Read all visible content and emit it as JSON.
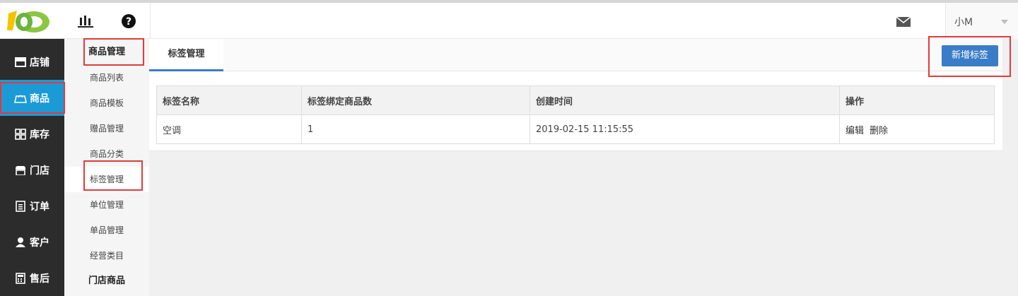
{
  "app": {
    "logo_icon": "logo-100-icon",
    "top_icons": [
      "bar-chart-icon",
      "help-circle-icon"
    ],
    "mail_icon": "mail-icon",
    "user_name": "小M",
    "colors": {
      "nav_bg": "#2c2c2c",
      "nav_active": "#1b9ad6",
      "primary": "#3a7cc7",
      "highlight": "#e23b3b"
    }
  },
  "nav": {
    "items": [
      {
        "label": "店铺",
        "icon": "store-icon"
      },
      {
        "label": "商品",
        "icon": "goods-icon"
      },
      {
        "label": "库存",
        "icon": "grid-icon"
      },
      {
        "label": "门店",
        "icon": "shop-icon"
      },
      {
        "label": "订单",
        "icon": "order-icon"
      },
      {
        "label": "客户",
        "icon": "user-icon"
      },
      {
        "label": "售后",
        "icon": "aftersale-icon"
      }
    ]
  },
  "subnav": {
    "heading": "商品管理",
    "items": [
      "商品列表",
      "商品模板",
      "赠品管理",
      "商品分类",
      "标签管理",
      "单位管理",
      "单品管理",
      "经营类目"
    ],
    "heading2": "门店商品"
  },
  "main": {
    "tab": "标签管理",
    "add_button": "新增标签",
    "table": {
      "headers": [
        "标签名称",
        "标签绑定商品数",
        "创建时间",
        "操作"
      ],
      "rows": [
        {
          "name": "空调",
          "count": "1",
          "created": "2019-02-15 11:15:55",
          "actions": [
            "编辑",
            "删除"
          ]
        }
      ]
    }
  }
}
